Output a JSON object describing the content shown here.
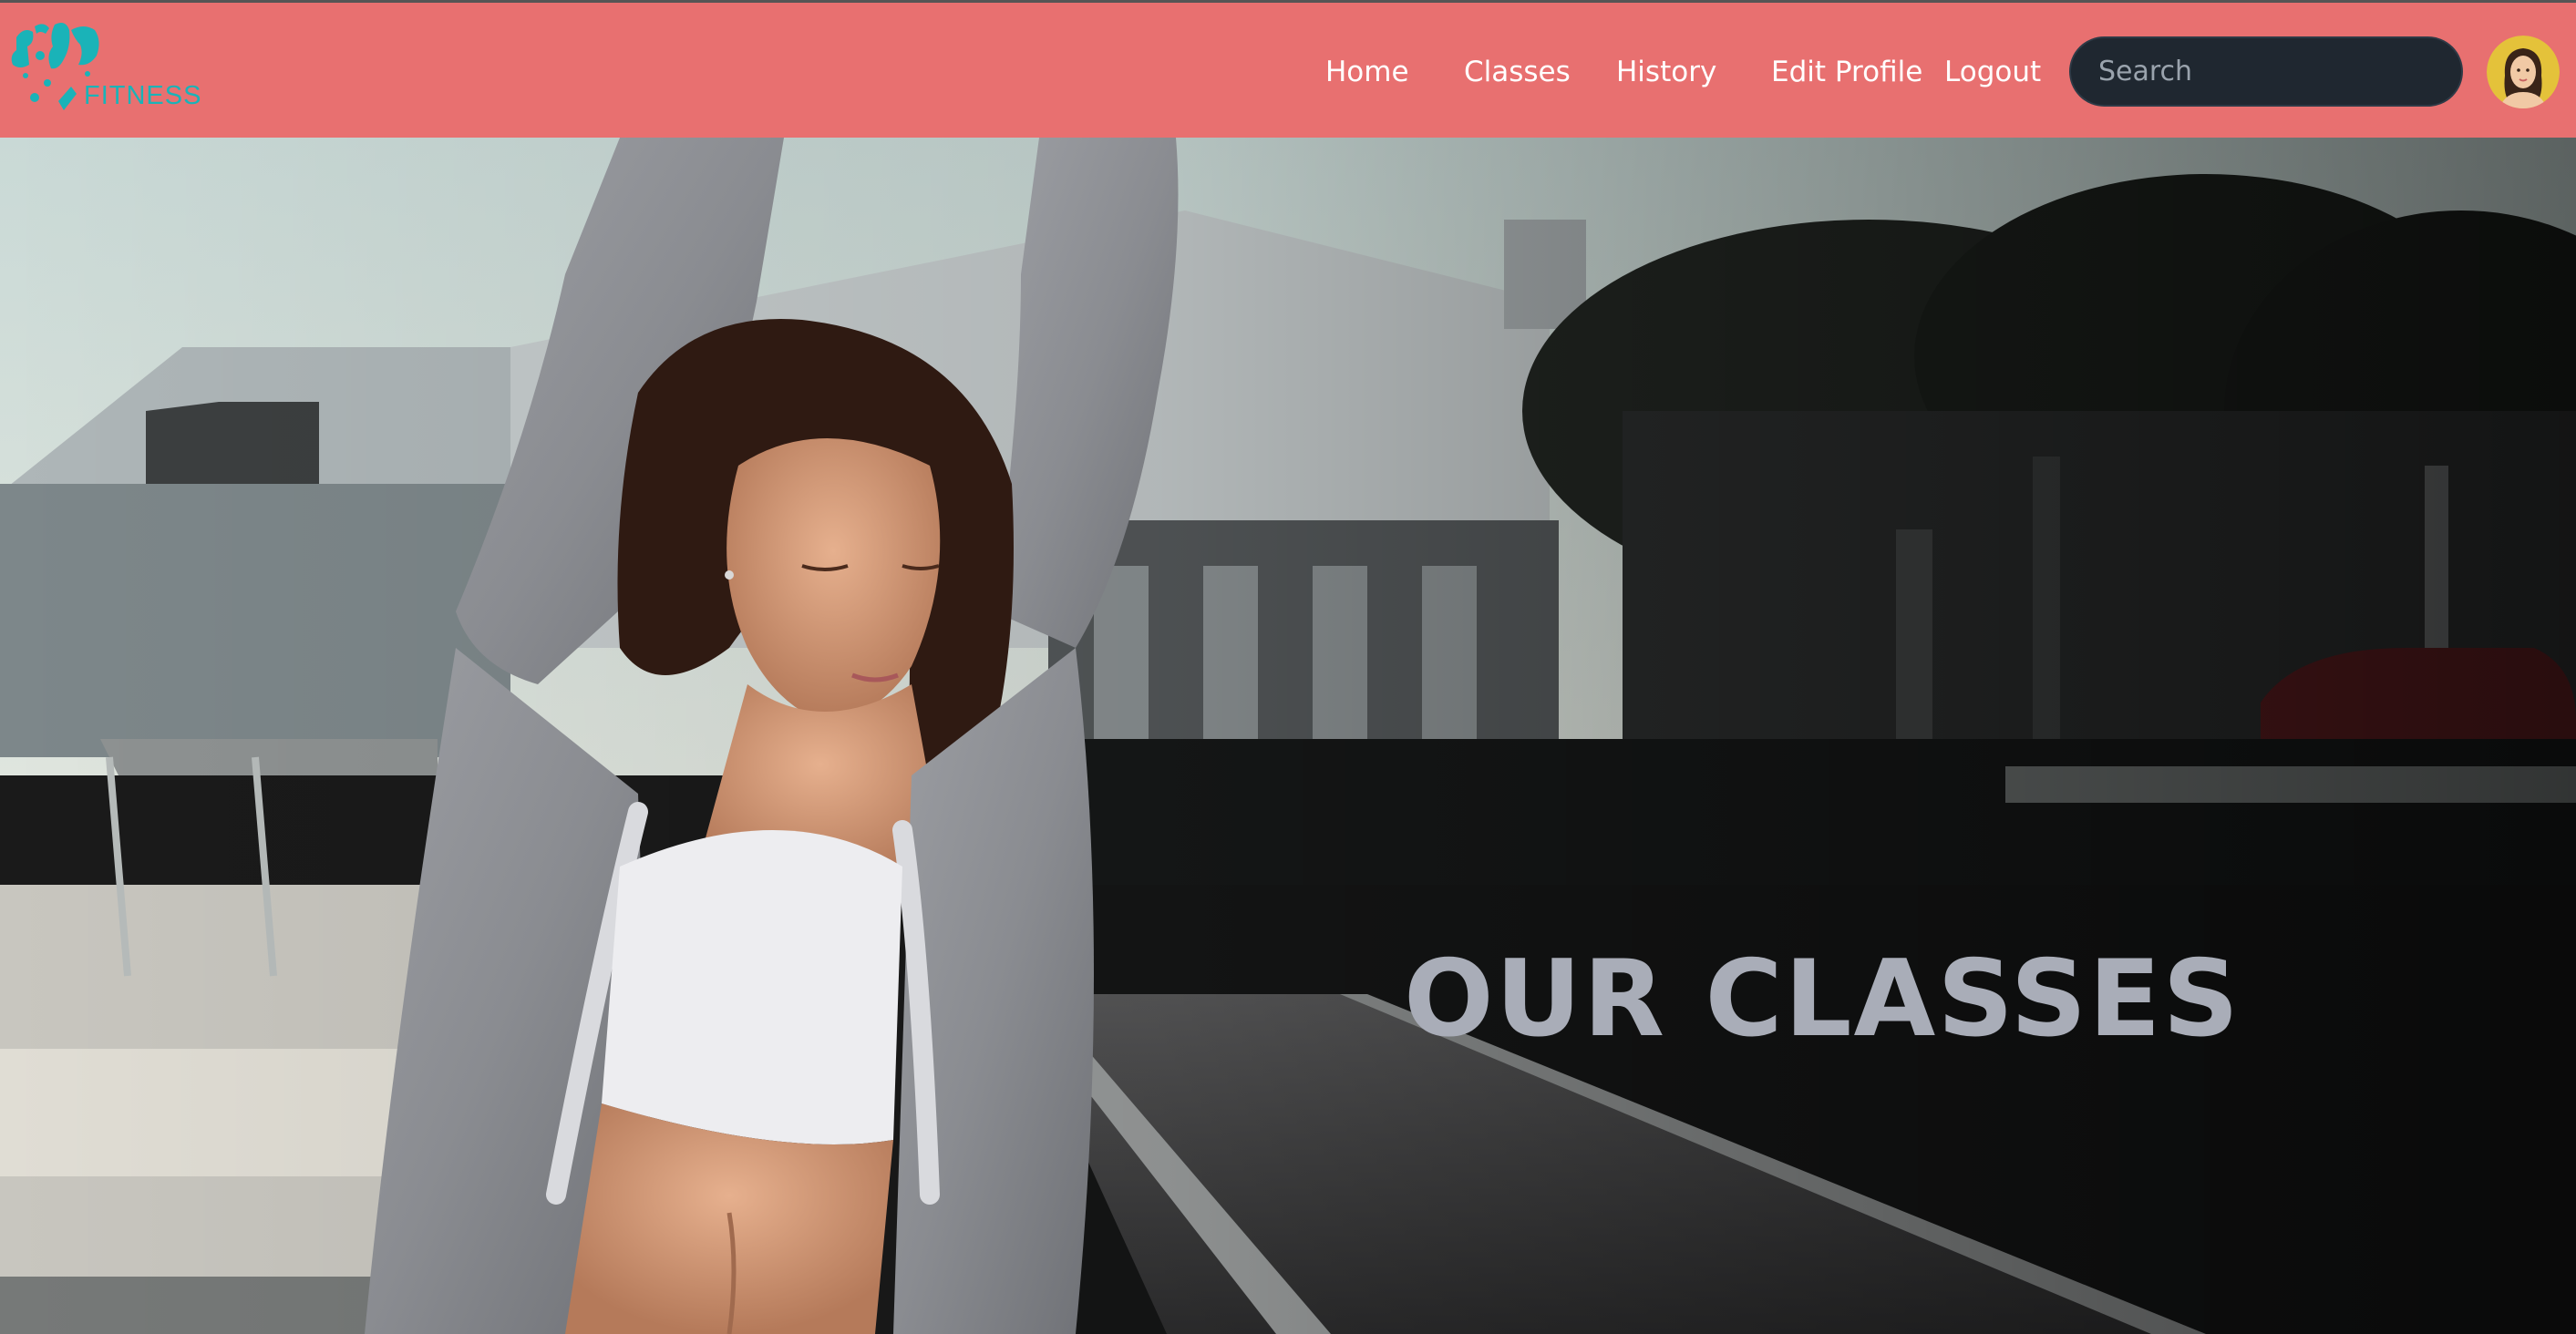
{
  "brand": {
    "logo_text": "FITNESS",
    "accent_color": "#1ab3b8",
    "navbar_color": "#e87070"
  },
  "nav": {
    "home": "Home",
    "classes": "Classes",
    "history": "History",
    "edit_profile": "Edit Profile",
    "logout": "Logout"
  },
  "search": {
    "placeholder": "Search",
    "value": ""
  },
  "user": {
    "avatar_icon": "user-avatar"
  },
  "hero": {
    "title": "OUR CLASSES",
    "image": "woman-stretching-on-pier"
  }
}
